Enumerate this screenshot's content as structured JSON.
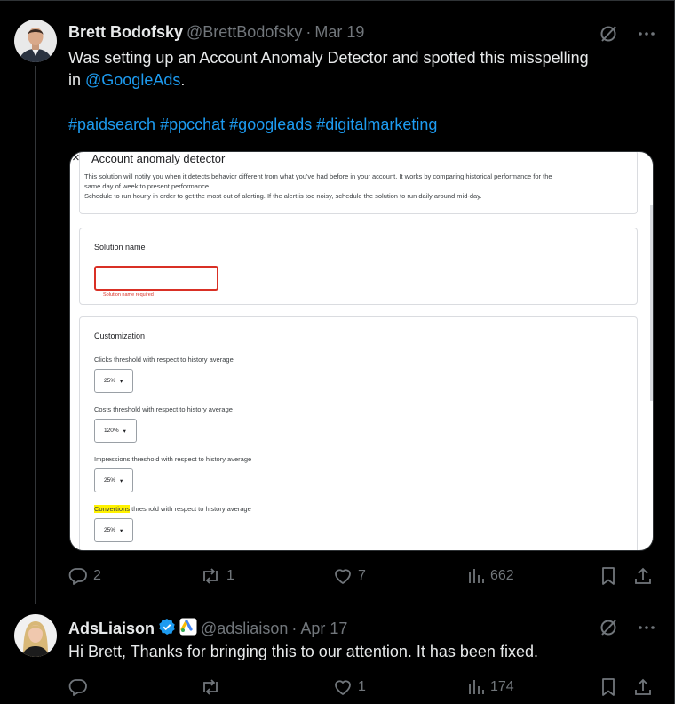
{
  "tweet1": {
    "name": "Brett Bodofsky",
    "handle": "@BrettBodofsky",
    "separator": "·",
    "date": "Mar 19",
    "text_line1": "Was setting up an Account Anomaly Detector and spotted this misspelling",
    "text_in": "in ",
    "mention": "@GoogleAds",
    "text_period": ".",
    "hashtags": [
      "#paidsearch",
      "#ppcchat",
      "#googleads",
      "#digitalmarketing"
    ],
    "stats": {
      "replies": "2",
      "reposts": "1",
      "likes": "7",
      "views": "662"
    },
    "media": {
      "title": "Account anomaly detector",
      "close": "×",
      "description_line1": "This solution will notify you when it detects behavior different from what you've had before in your account. It works by comparing historical performance for the",
      "description_line2": "same day of week to present performance.",
      "description_line3": "Schedule to run hourly in order to get the most out of alerting. If the alert is too noisy, schedule the solution to run daily around mid-day.",
      "solution_name_label": "Solution name",
      "solution_name_error": "Solution name required",
      "customization_label": "Customization",
      "thresholds": [
        {
          "label": "Clicks threshold with respect to history average",
          "value": "25%"
        },
        {
          "label": "Costs threshold with respect to history average",
          "value": "120%"
        },
        {
          "label": "Impressions threshold with respect to history average",
          "value": "25%"
        },
        {
          "label_highlight": "Convertions",
          "label_rest": " threshold with respect to history average",
          "value": "25%"
        }
      ]
    }
  },
  "tweet2": {
    "name": "AdsLiaison",
    "handle": "@adsliaison",
    "separator": "·",
    "date": "Apr 17",
    "text": "Hi Brett, Thanks for bringing this to our attention. It has been fixed.",
    "stats": {
      "likes": "1",
      "views": "174"
    }
  },
  "colors": {
    "background": "#000000",
    "text": "#e7e9ea",
    "muted": "#71767b",
    "link": "#1d9bf0",
    "verified": "#1d9bf0",
    "error": "#d93025"
  }
}
